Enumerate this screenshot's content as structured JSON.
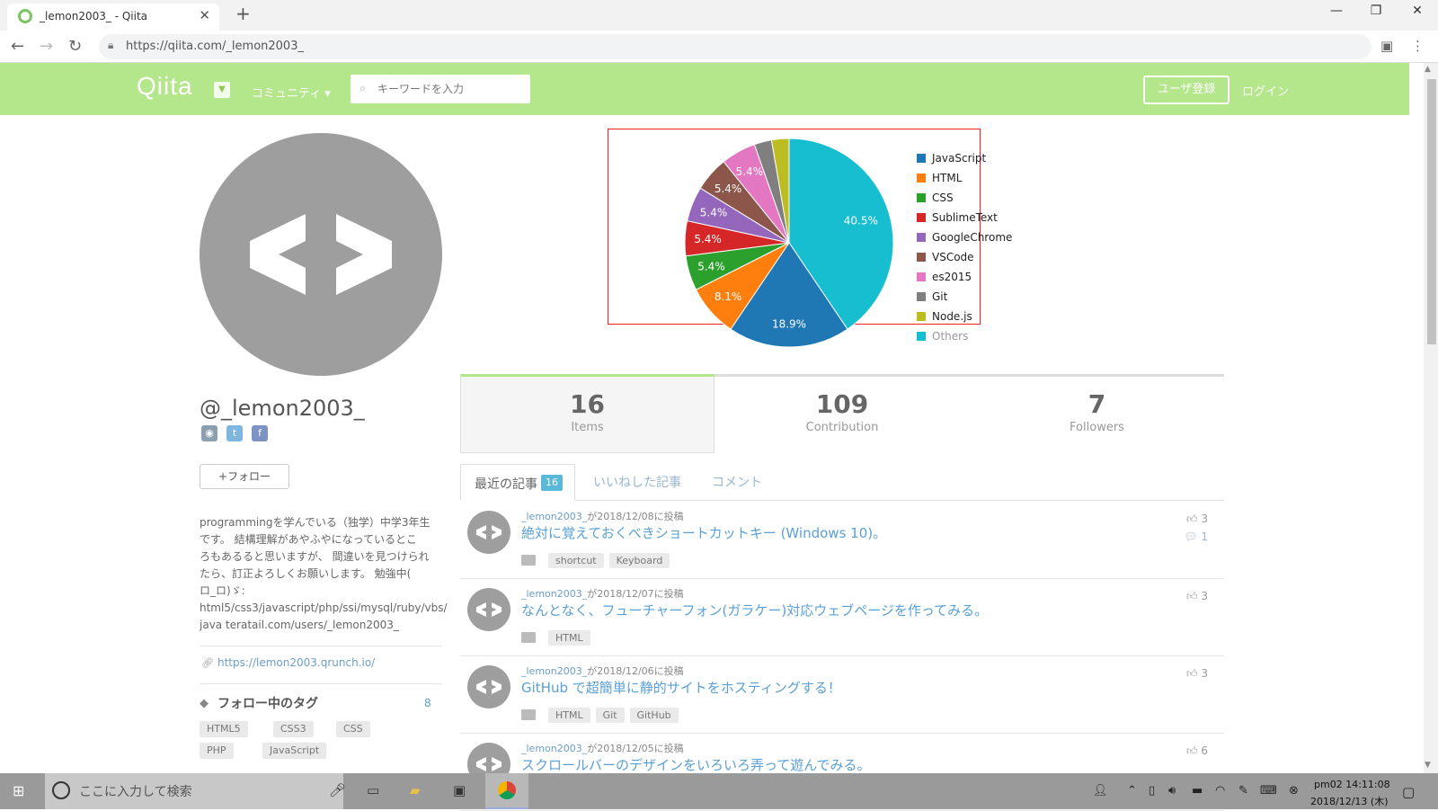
{
  "browser": {
    "tab_title": "_lemon2003_ - Qiita",
    "tab_close": "✕",
    "new_tab": "+",
    "win_min": "—",
    "win_max": "❐",
    "win_close": "✕",
    "url": "https://qiita.com/_lemon2003_"
  },
  "header": {
    "logo": "Qiita",
    "community": "コミュニティ ▾",
    "search_placeholder": "キーワードを入力",
    "signup": "ユーザ登録",
    "login": "ログイン"
  },
  "profile": {
    "username": "@_lemon2003_",
    "follow": "+フォロー",
    "bio_lines": [
      "programmingを学んでいる（独学）中学3年生",
      "です。 結構理解があやふやになっているとこ",
      "ろもあるると思いますが、 間違いを見つけられ",
      "たら、訂正よろしくお願いします。 勉強中(",
      "ロ_ロ)ゞ:",
      "html5/css3/javascript/php/ssi/mysql/ruby/vbs/",
      "java teratail.com/users/_lemon2003_"
    ],
    "site": "https://lemon2003.qrunch.io/",
    "tags_title": "フォロー中のタグ",
    "tags_count": "8",
    "tags": [
      "HTML5",
      "CSS3",
      "CSS",
      "PHP",
      "JavaScript"
    ]
  },
  "chart_data": {
    "type": "pie",
    "labels": [
      "JavaScript",
      "HTML",
      "CSS",
      "SublimeText",
      "GoogleChrome",
      "VSCode",
      "es2015",
      "Git",
      "Node.js",
      "Others"
    ],
    "values": [
      18.9,
      8.1,
      5.4,
      5.4,
      5.4,
      5.4,
      5.4,
      2.7,
      2.7,
      40.5
    ],
    "value_labels": [
      "18.9%",
      "8.1%",
      "5.4%",
      "5.4%",
      "5.4%",
      "5.4%",
      "5.4%",
      "",
      "",
      "40.5%"
    ],
    "colors": [
      "#1f77b4",
      "#ff7f0e",
      "#2ca02c",
      "#d62728",
      "#9467bd",
      "#8c564b",
      "#e377c2",
      "#7f7f7f",
      "#bcbd22",
      "#17becf"
    ],
    "legend": "right"
  },
  "stats": [
    {
      "num": "16",
      "label": "Items"
    },
    {
      "num": "109",
      "label": "Contribution"
    },
    {
      "num": "7",
      "label": "Followers"
    }
  ],
  "tabs": {
    "recent": "最近の記事",
    "recent_count": "16",
    "liked": "いいねした記事",
    "comment": "コメント"
  },
  "articles": [
    {
      "user": "_lemon2003_",
      "posted": "が2018/12/08に投稿",
      "title": "絶対に覚えておくべきショートカットキー (Windows 10)。",
      "tags": [
        "shortcut",
        "Keyboard"
      ],
      "likes": "3",
      "comments": "1"
    },
    {
      "user": "_lemon2003_",
      "posted": "が2018/12/07に投稿",
      "title": "なんとなく、フューチャーフォン(ガラケー)対応ウェブページを作ってみる。",
      "tags": [
        "HTML"
      ],
      "likes": "3",
      "comments": ""
    },
    {
      "user": "_lemon2003_",
      "posted": "が2018/12/06に投稿",
      "title": "GitHub で超簡単に静的サイトをホスティングする！",
      "tags": [
        "HTML",
        "Git",
        "GitHub"
      ],
      "likes": "3",
      "comments": ""
    },
    {
      "user": "_lemon2003_",
      "posted": "が2018/12/05に投稿",
      "title": "スクロールバーのデザインをいろいろ弄って遊んでみる。",
      "tags": [],
      "likes": "6",
      "comments": ""
    }
  ],
  "taskbar": {
    "search_placeholder": "ここに入力して検索",
    "time": "pm02 14:11:08",
    "date": "2018/12/13 (木)"
  }
}
